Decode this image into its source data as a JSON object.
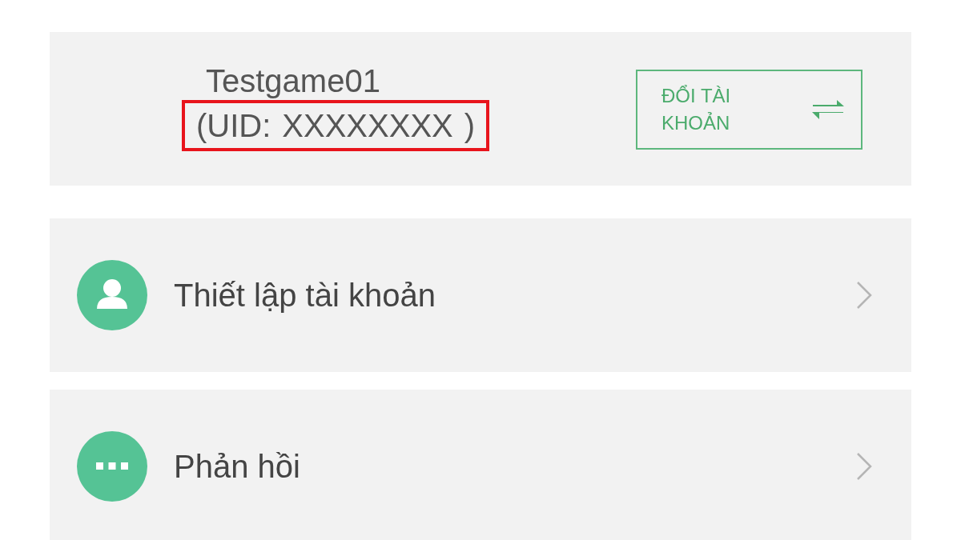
{
  "account": {
    "username": "Testgame01",
    "uid_label": "(UID:",
    "uid_value": "XXXXXXXX",
    "uid_close": ")",
    "uid_highlighted": true,
    "switch_button": {
      "label": "ĐỔI TÀI KHOẢN"
    }
  },
  "menu": [
    {
      "kind": "person",
      "label": "Thiết lập tài khoản"
    },
    {
      "kind": "dots",
      "label": "Phản hồi"
    }
  ]
}
